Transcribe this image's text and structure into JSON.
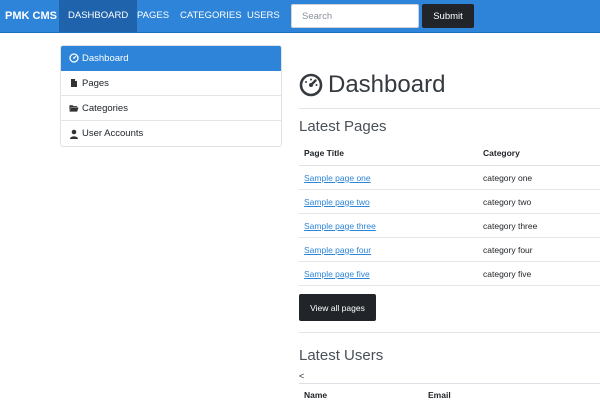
{
  "nav": {
    "brand": "PMK CMS",
    "links": [
      {
        "label": "DASHBOARD",
        "active": true
      },
      {
        "label": "PAGES",
        "active": false
      },
      {
        "label": "CATEGORIES",
        "active": false
      },
      {
        "label": "USERS",
        "active": false
      }
    ],
    "search_placeholder": "Search",
    "submit_label": "Submit"
  },
  "sidebar": {
    "items": [
      {
        "label": "Dashboard",
        "icon": "dashboard-icon",
        "active": true
      },
      {
        "label": "Pages",
        "icon": "file-icon",
        "active": false
      },
      {
        "label": "Categories",
        "icon": "folder-open-icon",
        "active": false
      },
      {
        "label": "User Accounts",
        "icon": "user-icon",
        "active": false
      }
    ]
  },
  "main": {
    "title": "Dashboard",
    "latest_pages": {
      "heading": "Latest Pages",
      "columns": [
        "Page Title",
        "Category"
      ],
      "rows": [
        {
          "title": "Sample page one",
          "category": "category one"
        },
        {
          "title": "Sample page two",
          "category": "category two"
        },
        {
          "title": "Sample page three",
          "category": "category three"
        },
        {
          "title": "Sample page four",
          "category": "category four"
        },
        {
          "title": "Sample page five",
          "category": "category five"
        }
      ],
      "view_all_label": "View all pages"
    },
    "latest_users": {
      "heading": "Latest Users",
      "stray_text": "<",
      "columns": [
        "Name",
        "Email"
      ]
    }
  },
  "colors": {
    "primary": "#2d84d8",
    "nav_active": "#1f63ad",
    "dark_button": "#212529"
  }
}
